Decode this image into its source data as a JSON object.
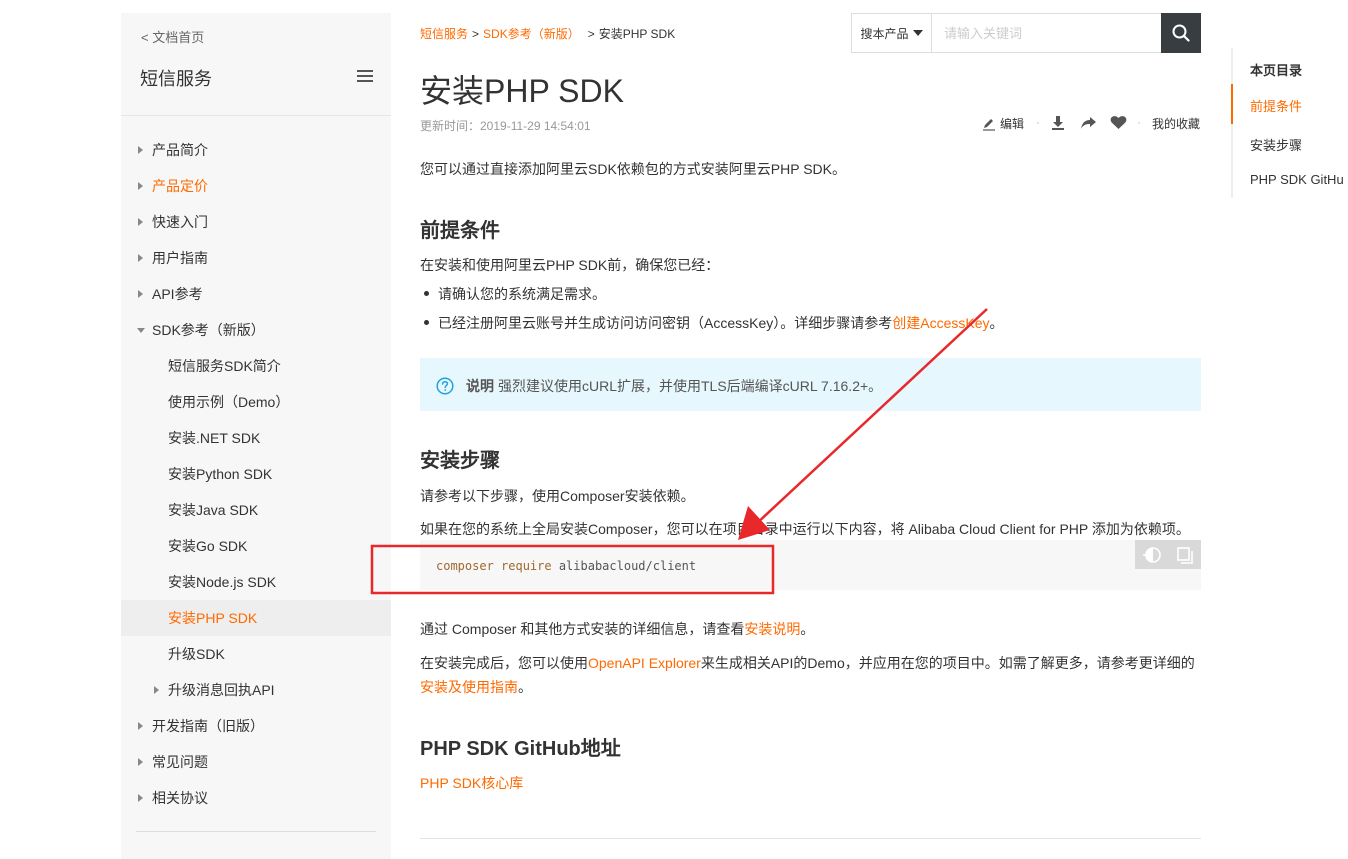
{
  "sidebar": {
    "back_label": "< 文档首页",
    "title": "短信服务",
    "items": [
      {
        "label": "产品简介",
        "level": 0,
        "arrow": "right",
        "state": "normal"
      },
      {
        "label": "产品定价",
        "level": 0,
        "arrow": "right",
        "state": "orange"
      },
      {
        "label": "快速入门",
        "level": 0,
        "arrow": "right",
        "state": "normal"
      },
      {
        "label": "用户指南",
        "level": 0,
        "arrow": "right",
        "state": "normal"
      },
      {
        "label": "API参考",
        "level": 0,
        "arrow": "right",
        "state": "normal"
      },
      {
        "label": "SDK参考（新版）",
        "level": 0,
        "arrow": "down",
        "state": "normal"
      },
      {
        "label": "短信服务SDK简介",
        "level": 1,
        "arrow": "none",
        "state": "normal"
      },
      {
        "label": "使用示例（Demo）",
        "level": 1,
        "arrow": "none",
        "state": "normal"
      },
      {
        "label": "安装.NET SDK",
        "level": 1,
        "arrow": "none",
        "state": "normal"
      },
      {
        "label": "安装Python SDK",
        "level": 1,
        "arrow": "none",
        "state": "normal"
      },
      {
        "label": "安装Java SDK",
        "level": 1,
        "arrow": "none",
        "state": "normal"
      },
      {
        "label": "安装Go SDK",
        "level": 1,
        "arrow": "none",
        "state": "normal"
      },
      {
        "label": "安装Node.js SDK",
        "level": 1,
        "arrow": "none",
        "state": "normal"
      },
      {
        "label": "安装PHP SDK",
        "level": 1,
        "arrow": "none",
        "state": "active"
      },
      {
        "label": "升级SDK",
        "level": 1,
        "arrow": "none",
        "state": "normal"
      },
      {
        "label": "升级消息回执API",
        "level": 1,
        "arrow": "right",
        "state": "normal"
      },
      {
        "label": "开发指南（旧版）",
        "level": 0,
        "arrow": "right",
        "state": "normal"
      },
      {
        "label": "常见问题",
        "level": 0,
        "arrow": "right",
        "state": "normal"
      },
      {
        "label": "相关协议",
        "level": 0,
        "arrow": "right",
        "state": "normal"
      }
    ]
  },
  "breadcrumb": {
    "items": [
      "短信服务",
      "SDK参考（新版）",
      "安装PHP SDK"
    ],
    "separator": ">"
  },
  "search": {
    "scope_label": "搜本产品",
    "placeholder": "请输入关键词"
  },
  "page": {
    "title": "安装PHP SDK",
    "updated": "更新时间：2019-11-29 14:54:01"
  },
  "actions": {
    "edit_label": "编辑",
    "favorites_label": "我的收藏"
  },
  "content": {
    "intro": "您可以通过直接添加阿里云SDK依赖包的方式安装阿里云PHP SDK。",
    "prereq_heading": "前提条件",
    "prereq_lead": "在安装和使用阿里云PHP SDK前，确保您已经：",
    "prereq_bullet1": "请确认您的系统满足需求。",
    "prereq_bullet2_pre": "已经注册阿里云账号并生成访问访问密钥（AccessKey）。详细步骤请参考",
    "prereq_bullet2_link": "创建AccessKey",
    "prereq_bullet2_post": "。",
    "note_label": "说明",
    "note_text": "强烈建议使用cURL扩展，并使用TLS后端编译cURL 7.16.2+。",
    "install_heading": "安装步骤",
    "install_p1": "请参考以下步骤，使用Composer安装依赖。",
    "install_p2": "如果在您的系统上全局安装Composer，您可以在项目目录中运行以下内容，将 Alibaba Cloud Client for PHP 添加为依赖项。",
    "code_kw": "composer require",
    "code_arg": "alibabacloud/client",
    "after_code_pre": "通过 Composer 和其他方式安装的详细信息，请查看",
    "after_code_link": "安装说明",
    "after_code_post": "。",
    "final_pre": "在安装完成后，您可以使用",
    "final_link1": "OpenAPI Explorer",
    "final_mid": "来生成相关API的Demo，并应用在您的项目中。如需了解更多，请参考更详细的",
    "final_link2": "安装及使用指南",
    "final_post": "。",
    "github_heading": "PHP SDK GitHub地址",
    "github_link": "PHP SDK核心库"
  },
  "toc": {
    "title": "本页目录",
    "items": [
      {
        "label": "前提条件",
        "active": true
      },
      {
        "label": "安装步骤",
        "active": false
      },
      {
        "label": "PHP SDK GitHu",
        "active": false
      }
    ]
  },
  "colors": {
    "accent": "#ff6a00",
    "annotation": "#e8282b",
    "note_bg": "#e6f7fd",
    "search_btn": "#373d41"
  }
}
